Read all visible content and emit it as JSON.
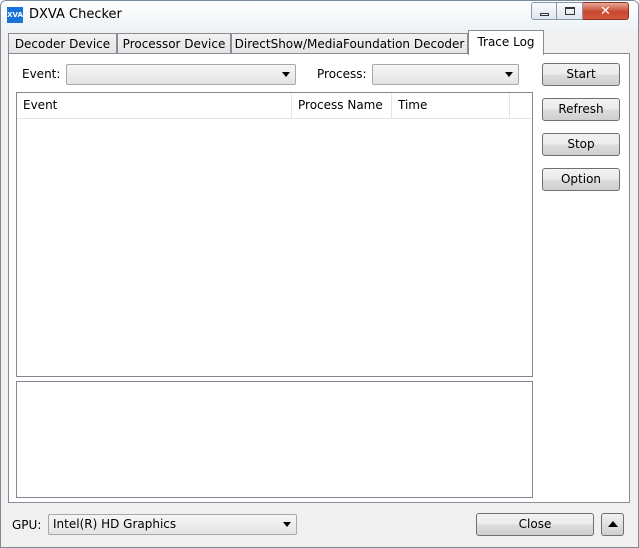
{
  "window": {
    "title": "DXVA Checker",
    "icon_text": "XVA"
  },
  "tabs": [
    {
      "label": "Decoder Device"
    },
    {
      "label": "Processor Device"
    },
    {
      "label": "DirectShow/MediaFoundation Decoder"
    },
    {
      "label": "Trace Log",
      "active": true
    }
  ],
  "filters": {
    "event_label": "Event:",
    "event_value": "",
    "process_label": "Process:",
    "process_value": ""
  },
  "table": {
    "columns": [
      "Event",
      "Process Name",
      "Time"
    ],
    "rows": []
  },
  "detail_text": "",
  "buttons": {
    "start": "Start",
    "refresh": "Refresh",
    "stop": "Stop",
    "option": "Option"
  },
  "footer": {
    "gpu_label": "GPU:",
    "gpu_value": "Intel(R) HD Graphics",
    "close": "Close"
  },
  "icons": {
    "minimize": "minimize-icon",
    "maximize": "maximize-icon",
    "close": "close-icon",
    "dropdown": "chevron-down-icon",
    "up": "chevron-up-icon"
  }
}
